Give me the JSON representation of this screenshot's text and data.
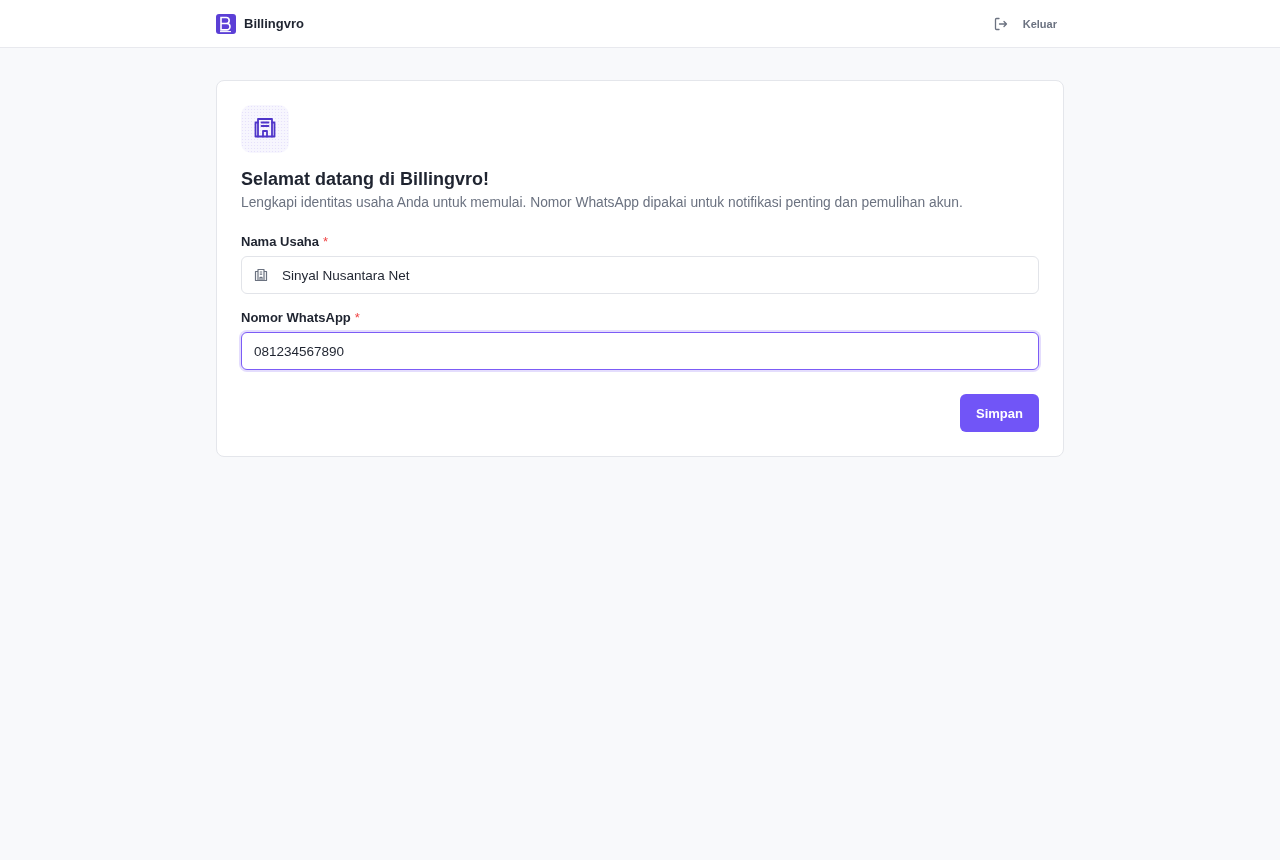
{
  "header": {
    "brand": "Billingvro",
    "logout_label": "Keluar"
  },
  "card": {
    "title": "Selamat datang di Billingvro!",
    "subtitle": "Lengkapi identitas usaha Anda untuk memulai. Nomor WhatsApp dipakai untuk notifikasi penting dan pemulihan akun.",
    "fields": [
      {
        "kind": "with-icon",
        "label": "Nama Usaha",
        "required_mark": "*",
        "value": "Sinyal Nusantara Net",
        "focused": false
      },
      {
        "kind": "plain",
        "label": "Nomor WhatsApp",
        "required_mark": "*",
        "value": "081234567890",
        "focused": true
      }
    ],
    "submit_label": "Simpan"
  }
}
